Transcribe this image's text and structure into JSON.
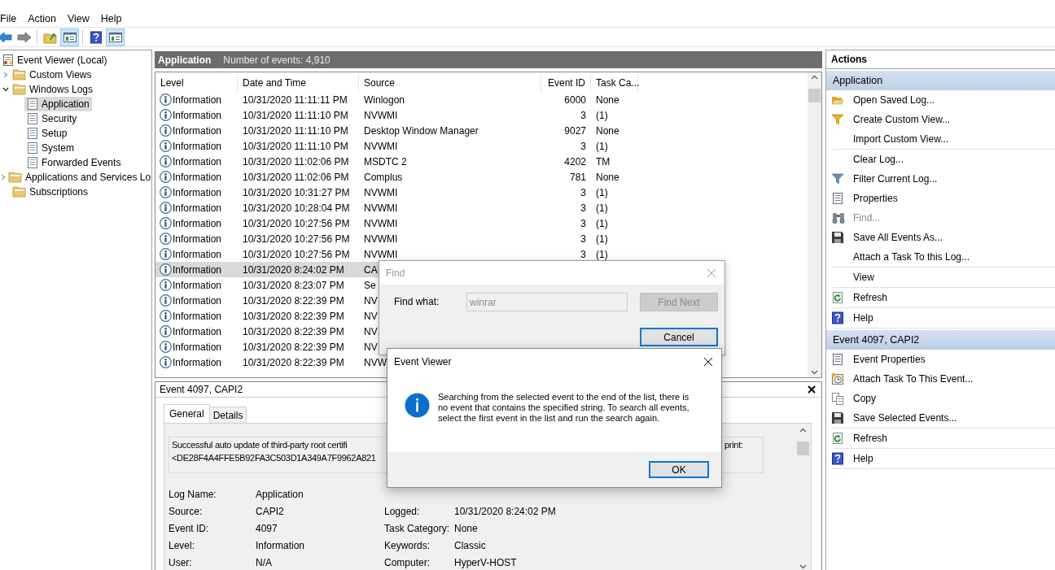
{
  "menu": [
    "File",
    "Action",
    "View",
    "Help"
  ],
  "toolbar": [
    {
      "kind": "back",
      "on": false
    },
    {
      "kind": "forward",
      "on": false
    },
    {
      "kind": "folder-up",
      "on": false
    },
    {
      "kind": "panel",
      "on": true
    },
    {
      "kind": "help",
      "on": false
    },
    {
      "kind": "panel",
      "on": true
    }
  ],
  "tree": {
    "label": "Event Viewer (Local)",
    "kind": "root",
    "selected": false,
    "children": [
      {
        "label": "Custom Views",
        "kind": "folder",
        "selected": false,
        "expanded": false
      },
      {
        "label": "Windows Logs",
        "kind": "folder",
        "selected": false,
        "expanded": true,
        "children": [
          {
            "label": "Application",
            "kind": "log",
            "selected": true
          },
          {
            "label": "Security",
            "kind": "log",
            "selected": false
          },
          {
            "label": "Setup",
            "kind": "log",
            "selected": false
          },
          {
            "label": "System",
            "kind": "log",
            "selected": false
          },
          {
            "label": "Forwarded Events",
            "kind": "log",
            "selected": false
          }
        ]
      },
      {
        "label": "Applications and Services Lo",
        "kind": "folder",
        "selected": false,
        "expanded": false
      },
      {
        "label": "Subscriptions",
        "kind": "folder",
        "selected": false
      }
    ]
  },
  "list_header": {
    "title": "Application",
    "subtitle": "Number of events: 4,910"
  },
  "table": {
    "columns": [
      "Level",
      "Date and Time",
      "Source",
      "Event ID",
      "Task Ca..."
    ],
    "rows": [
      {
        "kind": "information",
        "level": "Information",
        "date_time": "10/31/2020 11:11:11 PM",
        "source": "Winlogon",
        "event_id": "6000",
        "task_category": "None",
        "selected": false
      },
      {
        "kind": "information",
        "level": "Information",
        "date_time": "10/31/2020 11:11:10 PM",
        "source": "NVWMI",
        "event_id": "3",
        "task_category": "(1)",
        "selected": false
      },
      {
        "kind": "information",
        "level": "Information",
        "date_time": "10/31/2020 11:11:10 PM",
        "source": "Desktop Window Manager",
        "event_id": "9027",
        "task_category": "None",
        "selected": false
      },
      {
        "kind": "information",
        "level": "Information",
        "date_time": "10/31/2020 11:11:10 PM",
        "source": "NVWMI",
        "event_id": "3",
        "task_category": "(1)",
        "selected": false
      },
      {
        "kind": "information",
        "level": "Information",
        "date_time": "10/31/2020 11:02:06 PM",
        "source": "MSDTC 2",
        "event_id": "4202",
        "task_category": "TM",
        "selected": false
      },
      {
        "kind": "information",
        "level": "Information",
        "date_time": "10/31/2020 11:02:06 PM",
        "source": "Complus",
        "event_id": "781",
        "task_category": "None",
        "selected": false
      },
      {
        "kind": "information",
        "level": "Information",
        "date_time": "10/31/2020 10:31:27 PM",
        "source": "NVWMI",
        "event_id": "3",
        "task_category": "(1)",
        "selected": false
      },
      {
        "kind": "information",
        "level": "Information",
        "date_time": "10/31/2020 10:28:04 PM",
        "source": "NVWMI",
        "event_id": "3",
        "task_category": "(1)",
        "selected": false
      },
      {
        "kind": "information",
        "level": "Information",
        "date_time": "10/31/2020 10:27:56 PM",
        "source": "NVWMI",
        "event_id": "3",
        "task_category": "(1)",
        "selected": false
      },
      {
        "kind": "information",
        "level": "Information",
        "date_time": "10/31/2020 10:27:56 PM",
        "source": "NVWMI",
        "event_id": "3",
        "task_category": "(1)",
        "selected": false
      },
      {
        "kind": "information",
        "level": "Information",
        "date_time": "10/31/2020 10:27:56 PM",
        "source": "NVWMI",
        "event_id": "3",
        "task_category": "(1)",
        "selected": false
      },
      {
        "kind": "information",
        "level": "Information",
        "date_time": "10/31/2020 8:24:02 PM",
        "source": "CA",
        "selected": true
      },
      {
        "kind": "information",
        "level": "Information",
        "date_time": "10/31/2020 8:23:07 PM",
        "source": "Se",
        "selected": false
      },
      {
        "kind": "information",
        "level": "Information",
        "date_time": "10/31/2020 8:22:39 PM",
        "source": "NV",
        "selected": false
      },
      {
        "kind": "information",
        "level": "Information",
        "date_time": "10/31/2020 8:22:39 PM",
        "source": "NV",
        "selected": false
      },
      {
        "kind": "information",
        "level": "Information",
        "date_time": "10/31/2020 8:22:39 PM",
        "source": "NV",
        "selected": false
      },
      {
        "kind": "information",
        "level": "Information",
        "date_time": "10/31/2020 8:22:39 PM",
        "source": "NV",
        "selected": false
      },
      {
        "kind": "information",
        "level": "Information",
        "date_time": "10/31/2020 8:22:39 PM",
        "source": "NVW",
        "selected": false
      }
    ]
  },
  "detail": {
    "title": "Event 4097, CAPI2",
    "tabs": [
      {
        "label": "General",
        "selected": true
      },
      {
        "label": "Details",
        "selected": false
      }
    ],
    "message_line_1": "Successful auto update of third-party root certifi",
    "message_line_1_end": "print:",
    "message_line_2": "<DE28F4A4FFE5B92FA3C503D1A349A7F9962A821",
    "fields": [
      {
        "label": "Log Name:",
        "value": "Application"
      },
      {
        "label": "Source:",
        "value": "CAPI2",
        "label_2": "Logged:",
        "value_2": "10/31/2020 8:24:02 PM"
      },
      {
        "label": "Event ID:",
        "value": "4097",
        "label_2": "Task Category:",
        "value_2": "None"
      },
      {
        "label": "Level:",
        "value": "Information",
        "label_2": "Keywords:",
        "value_2": "Classic"
      },
      {
        "label": "User:",
        "value": "N/A",
        "label_2": "Computer:",
        "value_2": "HyperV-HOST"
      }
    ]
  },
  "actions": {
    "title": "Actions",
    "sections": [
      {
        "title": "Application",
        "groups": [
          [
            {
              "label": "Open Saved Log...",
              "kind": "folder-open",
              "disabled": false
            },
            {
              "label": "Create Custom View...",
              "kind": "funnel-yellow",
              "disabled": false
            },
            {
              "label": "Import Custom View...",
              "kind": "plain",
              "disabled": false
            }
          ],
          [
            {
              "label": "Clear Log...",
              "kind": "plain",
              "disabled": false
            },
            {
              "label": "Filter Current Log...",
              "kind": "funnel",
              "disabled": false
            },
            {
              "label": "Properties",
              "kind": "properties",
              "disabled": false
            },
            {
              "label": "Find...",
              "kind": "binoculars",
              "disabled": true
            },
            {
              "label": "Save All Events As...",
              "kind": "save",
              "disabled": false
            },
            {
              "label": "Attach a Task To this Log...",
              "kind": "plain",
              "disabled": false
            }
          ],
          [
            {
              "label": "View",
              "kind": "plain",
              "disabled": false
            }
          ],
          [
            {
              "label": "Refresh",
              "kind": "refresh",
              "disabled": false
            }
          ],
          [
            {
              "label": "Help",
              "kind": "help",
              "disabled": false
            }
          ]
        ]
      },
      {
        "title": "Event 4097, CAPI2",
        "groups": [
          [
            {
              "label": "Event Properties",
              "kind": "properties",
              "disabled": false
            },
            {
              "label": "Attach Task To This Event...",
              "kind": "clock",
              "disabled": false
            },
            {
              "label": "Copy",
              "kind": "copy",
              "disabled": false
            },
            {
              "label": "Save Selected Events...",
              "kind": "save",
              "disabled": false
            }
          ],
          [
            {
              "label": "Refresh",
              "kind": "refresh",
              "disabled": false
            }
          ],
          [
            {
              "label": "Help",
              "kind": "help",
              "disabled": false
            }
          ]
        ]
      }
    ]
  },
  "find_dialog": {
    "title": "Find",
    "active": false,
    "label": "Find what:",
    "value": "winrar",
    "buttons": [
      {
        "label": "Find Next",
        "disabled": true,
        "default": false
      },
      {
        "label": "Cancel",
        "disabled": false,
        "default": true
      }
    ]
  },
  "message_box": {
    "title": "Event Viewer",
    "text": "Searching from the selected event to the end of the list, there is no event that contains the specified string. To search all events, select the first event in the list and run the search again.",
    "button": "OK"
  }
}
